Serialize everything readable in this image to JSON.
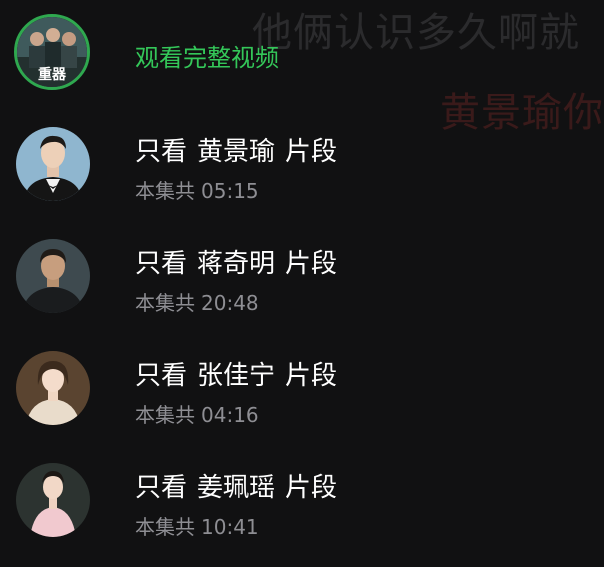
{
  "background_subtitle": {
    "line1": "他俩认识多久啊就",
    "line2": "黄景瑜你"
  },
  "full_video": {
    "title": "观看完整视频",
    "poster_label": "重器",
    "accent_color": "#34c759"
  },
  "clips": [
    {
      "prefix": "只看",
      "name": "黄景瑜",
      "suffix": "片段",
      "duration_label": "本集共",
      "duration": "05:15"
    },
    {
      "prefix": "只看",
      "name": "蒋奇明",
      "suffix": "片段",
      "duration_label": "本集共",
      "duration": "20:48"
    },
    {
      "prefix": "只看",
      "name": "张佳宁",
      "suffix": "片段",
      "duration_label": "本集共",
      "duration": "04:16"
    },
    {
      "prefix": "只看",
      "name": "姜珮瑶",
      "suffix": "片段",
      "duration_label": "本集共",
      "duration": "10:41"
    }
  ]
}
